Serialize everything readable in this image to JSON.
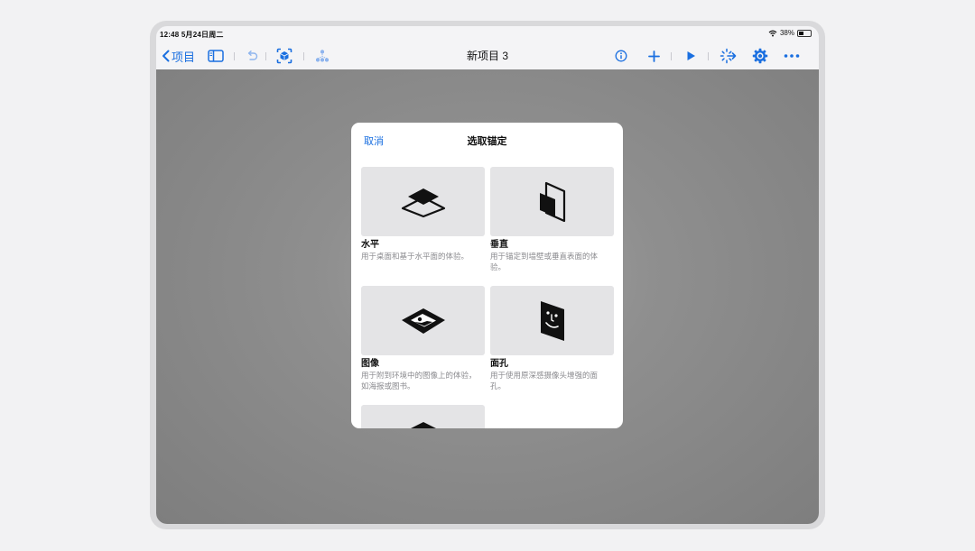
{
  "status": {
    "time_date": "12:48  5月24日周二",
    "battery": "38%"
  },
  "toolbar": {
    "back_label": "项目",
    "doc_title": "新项目 3",
    "icons": [
      "chevron-left-icon",
      "sidebar-icon",
      "undo-icon",
      "ar-anchor-icon",
      "scene-tree-icon",
      "info-icon",
      "plus-icon",
      "play-icon",
      "behaviors-icon",
      "gear-icon",
      "more-icon"
    ]
  },
  "sheet": {
    "cancel_label": "取消",
    "title": "选取锚定",
    "cards": [
      {
        "title": "水平",
        "desc": "用于桌面和基于水平面的体验。",
        "icon": "horizontal-plane-icon"
      },
      {
        "title": "垂直",
        "desc": "用于锚定到墙壁或垂直表面的体验。",
        "icon": "vertical-plane-icon"
      },
      {
        "title": "图像",
        "desc": "用于附到环境中的图像上的体验，如海报或图书。",
        "icon": "image-anchor-icon"
      },
      {
        "title": "面孔",
        "desc": "用于使用原深感摄像头增强的面孔。",
        "icon": "face-anchor-icon"
      },
      {
        "title": "",
        "desc": "",
        "icon": "object-anchor-icon"
      }
    ]
  },
  "colors": {
    "accent": "#1a6fe0",
    "canvas": "#8c8c8c",
    "tile": "#e4e4e6"
  }
}
